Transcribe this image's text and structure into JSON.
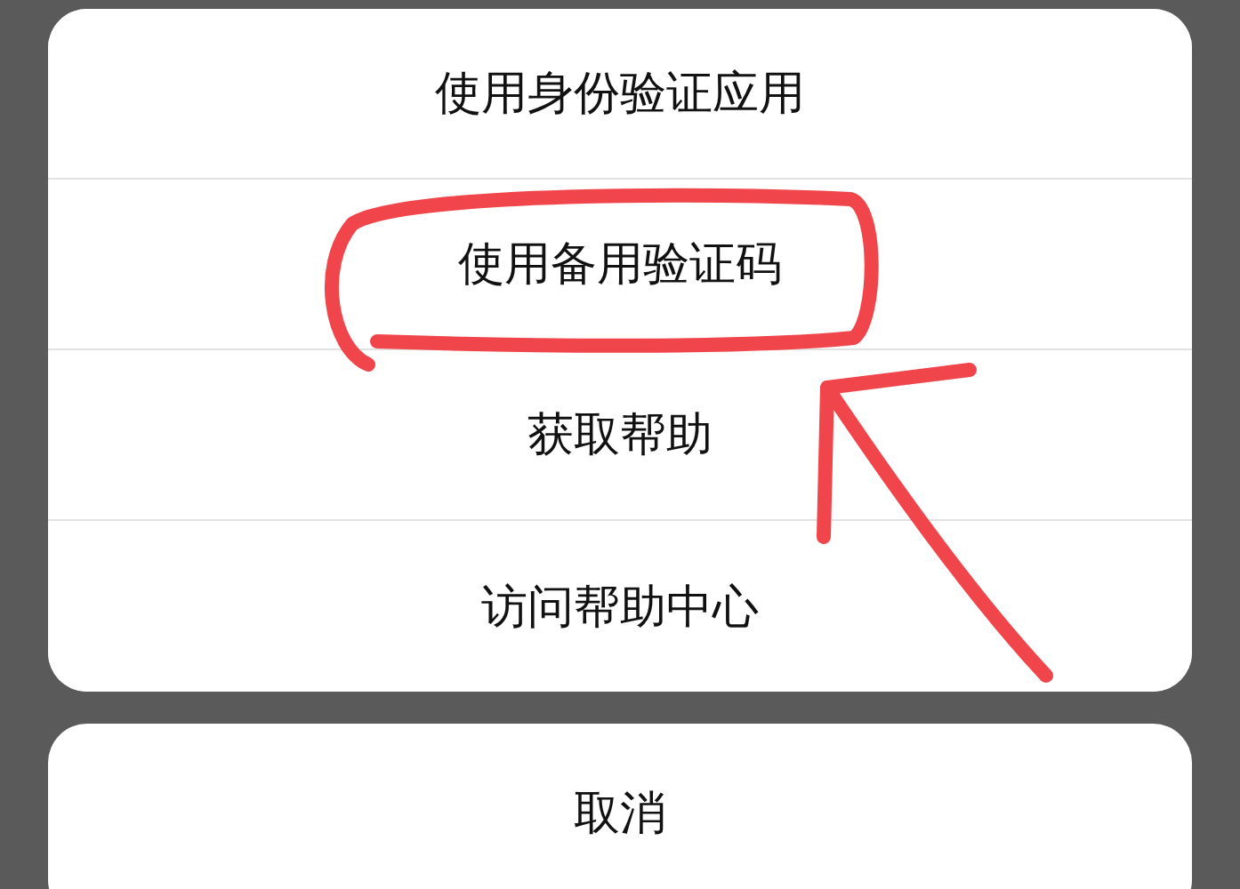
{
  "action_sheet": {
    "options": [
      {
        "label": "使用身份验证应用"
      },
      {
        "label": "使用备用验证码"
      },
      {
        "label": "获取帮助"
      },
      {
        "label": "访问帮助中心"
      }
    ]
  },
  "cancel_button": {
    "label": "取消"
  }
}
